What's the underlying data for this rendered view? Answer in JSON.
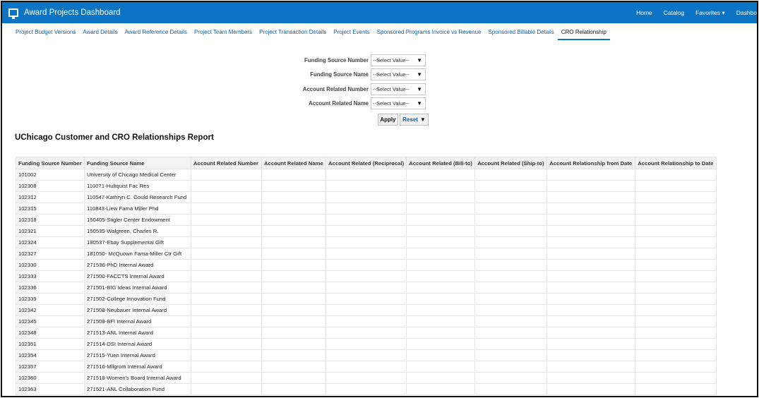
{
  "header": {
    "title": "Award Projects Dashboard",
    "nav": {
      "home": "Home",
      "catalog": "Catalog",
      "favorites": "Favorites",
      "dashboards": "Dashbo"
    }
  },
  "tabs": [
    {
      "label": "Project Budget Versions",
      "active": false
    },
    {
      "label": "Award Details",
      "active": false
    },
    {
      "label": "Award Reference Details",
      "active": false
    },
    {
      "label": "Project Team Members",
      "active": false
    },
    {
      "label": "Project Transaction Details",
      "active": false
    },
    {
      "label": "Project Events",
      "active": false
    },
    {
      "label": "Sponsored Programs Invoice vs Revenue",
      "active": false
    },
    {
      "label": "Sponsored Billable Details",
      "active": false
    },
    {
      "label": "CRO Relationship",
      "active": true
    }
  ],
  "prompts": [
    {
      "label": "Funding Source Number",
      "value": "--Select Value--"
    },
    {
      "label": "Funding Source Name",
      "value": "--Select Value--"
    },
    {
      "label": "Account Related Number",
      "value": "--Select Value--"
    },
    {
      "label": "Account Related Name",
      "value": "--Select Value--"
    }
  ],
  "buttons": {
    "apply": "Apply",
    "reset": "Reset"
  },
  "report": {
    "title": "UChicago Customer and CRO Relationships Report",
    "columns": [
      "Funding Source Number",
      "Funding Source Name",
      "Account Related Number",
      "Account Related Name",
      "Account Related (Reciprocal)",
      "Account Related (Bill-to)",
      "Account Related (Ship-to)",
      "Account Relationship from Date",
      "Account Relationship to Date"
    ],
    "rows": [
      [
        "101002",
        "University of Chicago Medical Center"
      ],
      [
        "102308",
        "110071-Hultquist Fac Res"
      ],
      [
        "102312",
        "110547-Kathryn C. Gould Research Fund"
      ],
      [
        "102315",
        "110843-Liew Fama Miller Phd"
      ],
      [
        "102318",
        "150405-Stigler Center Endowment"
      ],
      [
        "102321",
        "150535-Walgreen, Charles R."
      ],
      [
        "102324",
        "180537-Ebay Supplemental Gift"
      ],
      [
        "102327",
        "181050- McQuown Fama-Miller Ctr Gift"
      ],
      [
        "102330",
        "271536-PhD Internal Award"
      ],
      [
        "102333",
        "271500-FACCTS Internal Award"
      ],
      [
        "102336",
        "271501-BIG Ideas Internal Award"
      ],
      [
        "102339",
        "271502-College Innovation Fund"
      ],
      [
        "102342",
        "271508-Neubauer Internal Award"
      ],
      [
        "102345",
        "271509-BFI Internal Award"
      ],
      [
        "102348",
        "271513-ANL Internal Award"
      ],
      [
        "102351",
        "271514-DSI Internal Award"
      ],
      [
        "102354",
        "271515-Yuen Internal Award"
      ],
      [
        "102357",
        "271516-Milgrom Internal Award"
      ],
      [
        "102360",
        "271518-Women's Board Internal Award"
      ],
      [
        "102363",
        "271521-ANL Collaboration Fund"
      ]
    ]
  }
}
